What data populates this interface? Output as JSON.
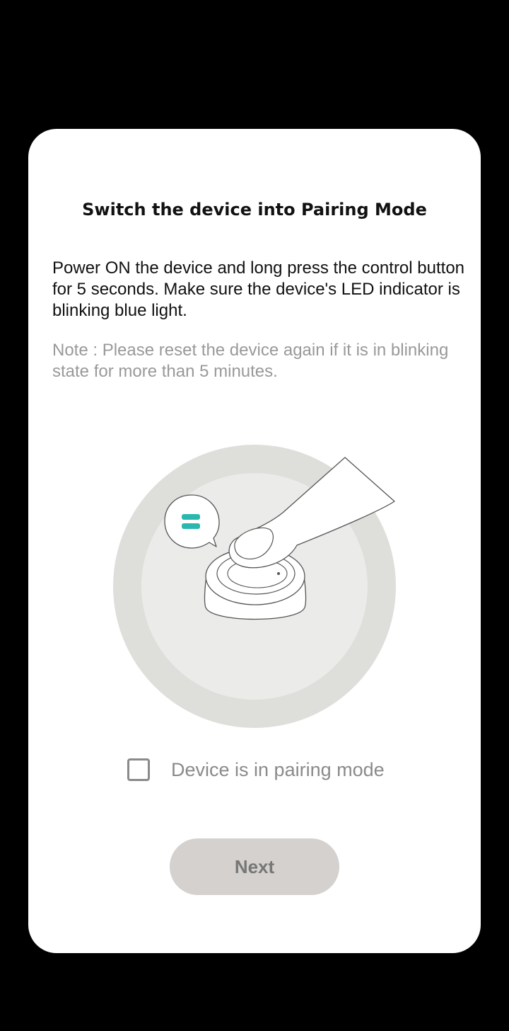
{
  "dialog": {
    "title": "Switch the device into Pairing Mode",
    "instructions": "Power ON the device and long press the control button for 5 seconds. Make sure the device's LED indicator is blinking blue light.",
    "note": "Note : Please reset the device again if it is in blinking state for more than 5 minutes.",
    "illustration": {
      "icon": "finger-pressing-button-illustration",
      "led_color": "#2ab7b0"
    },
    "checkbox": {
      "label": "Device is in pairing mode",
      "checked": false
    },
    "next_button": {
      "label": "Next",
      "enabled": false
    }
  },
  "colors": {
    "background": "#000000",
    "card": "#ffffff",
    "title_text": "#111111",
    "note_text": "#999999",
    "button_disabled": "#d4d1cf",
    "illustration_outer": "#dededb",
    "illustration_inner": "#ebebea"
  }
}
